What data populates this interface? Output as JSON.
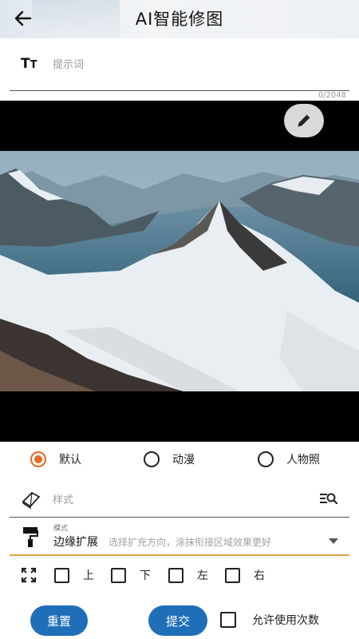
{
  "header": {
    "title": "AI智能修图",
    "back_icon": "arrow-left-icon"
  },
  "prompt": {
    "placeholder": "提示词",
    "value": "",
    "counter": "0/2048",
    "icon": "text-size-icon",
    "icon_text_big": "T",
    "icon_text_small": "T"
  },
  "image": {
    "edit_icon": "pencil-icon",
    "description_colors": {
      "sky": "#a8bcc8",
      "lake": "#3f6c85",
      "snow": "#eef2f5",
      "rock": "#3a3430"
    }
  },
  "style_type": {
    "options": [
      {
        "label": "默认",
        "checked": true
      },
      {
        "label": "动漫",
        "checked": false
      },
      {
        "label": "人物照",
        "checked": false
      }
    ],
    "accent": "#e76a1f"
  },
  "style": {
    "placeholder": "样式",
    "value": "",
    "icon": "cube-icon",
    "action_icon": "list-search-icon"
  },
  "mode": {
    "small_label": "模式",
    "value": "边缘扩展",
    "hint": "选择扩充方向，涂抹衔接区域效果更好",
    "icon": "paint-roller-icon",
    "underline": "#e0a24a"
  },
  "directions": {
    "icon": "expand-icon",
    "options": [
      {
        "label": "上",
        "checked": false
      },
      {
        "label": "下",
        "checked": false
      },
      {
        "label": "左",
        "checked": false
      },
      {
        "label": "右",
        "checked": false
      }
    ]
  },
  "actions": {
    "reset": "重置",
    "submit": "提交",
    "allow_label": "允许使用次数",
    "allow_checked": false,
    "button_color": "#1f6fb8"
  }
}
